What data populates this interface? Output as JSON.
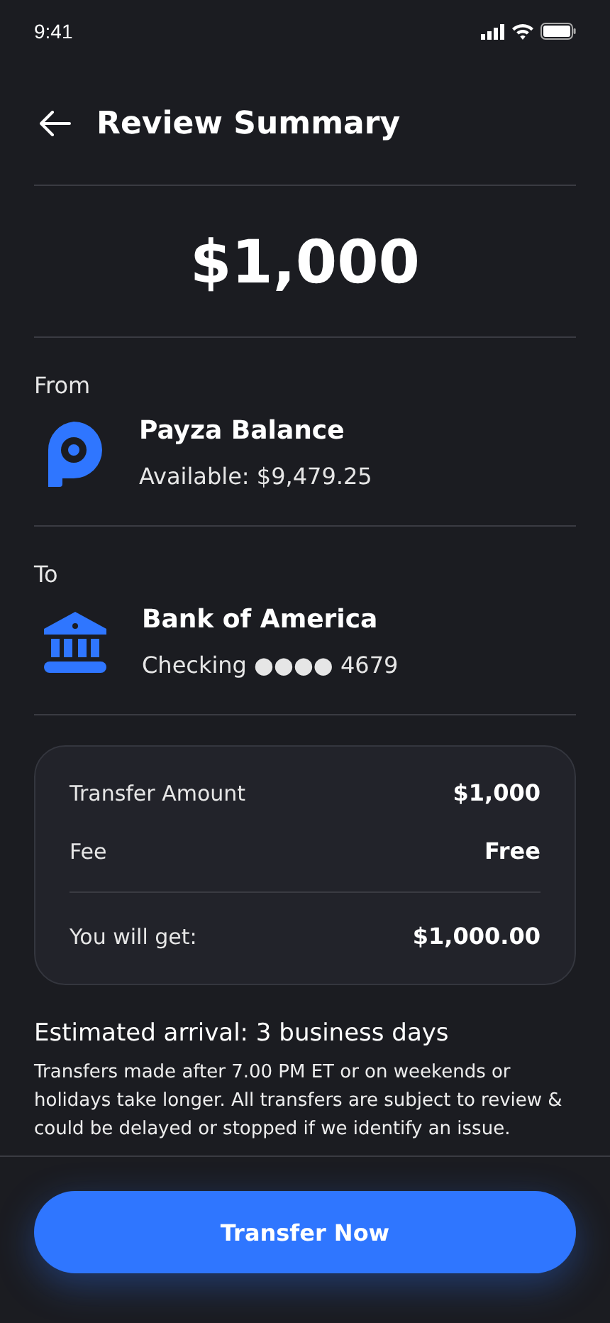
{
  "status_bar": {
    "time": "9:41"
  },
  "header": {
    "title": "Review Summary"
  },
  "amount": "$1,000",
  "accounts": [
    {
      "label": "From",
      "kind": "wallet",
      "name": "Payza Balance",
      "detail": "Available: $9,479.25"
    },
    {
      "label": "To",
      "kind": "bank",
      "name": "Bank of America",
      "detail": "Checking ●●●● 4679"
    }
  ],
  "summary": {
    "rows": [
      {
        "label": "Transfer Amount",
        "value": "$1,000"
      },
      {
        "label": "Fee",
        "value": "Free"
      }
    ],
    "total": {
      "label": "You will get:",
      "value": "$1,000.00"
    }
  },
  "arrival": "Estimated arrival: 3 business days",
  "note": "Transfers made after 7.00 PM ET or on weekends or holidays take longer. All transfers are subject to review & could be delayed or stopped if we identify an issue.",
  "button": "Transfer Now"
}
